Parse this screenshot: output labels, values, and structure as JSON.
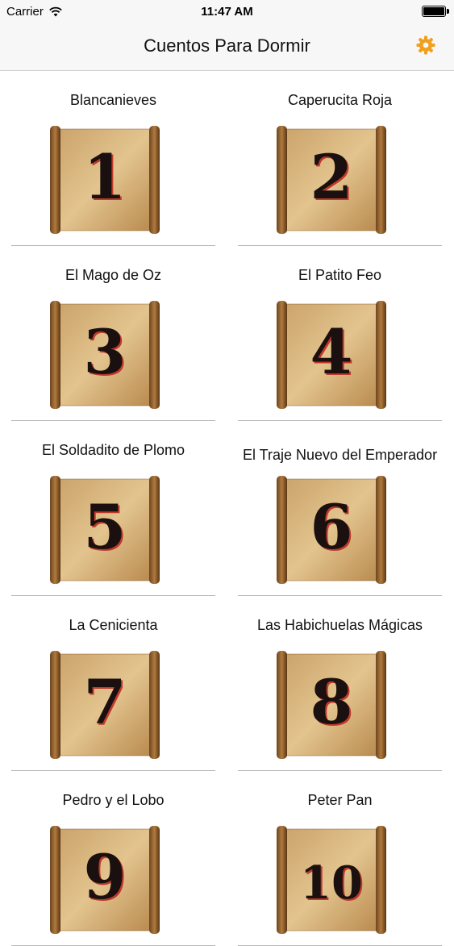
{
  "status_bar": {
    "carrier": "Carrier",
    "time": "11:47 AM"
  },
  "navbar": {
    "title": "Cuentos Para Dormir",
    "settings_icon": "gear-icon",
    "accent_color": "#f0a020"
  },
  "stories": [
    {
      "title": "Blancanieves",
      "number": "1"
    },
    {
      "title": "Caperucita Roja",
      "number": "2"
    },
    {
      "title": "El Mago de Oz",
      "number": "3"
    },
    {
      "title": "El Patito Feo",
      "number": "4"
    },
    {
      "title": "El Soldadito de Plomo",
      "number": "5"
    },
    {
      "title": "El Traje Nuevo del Emperador",
      "number": "6"
    },
    {
      "title": "La Cenicienta",
      "number": "7"
    },
    {
      "title": "Las Habichuelas Mágicas",
      "number": "8"
    },
    {
      "title": "Pedro y el Lobo",
      "number": "9"
    },
    {
      "title": "Peter Pan",
      "number": "10"
    }
  ]
}
